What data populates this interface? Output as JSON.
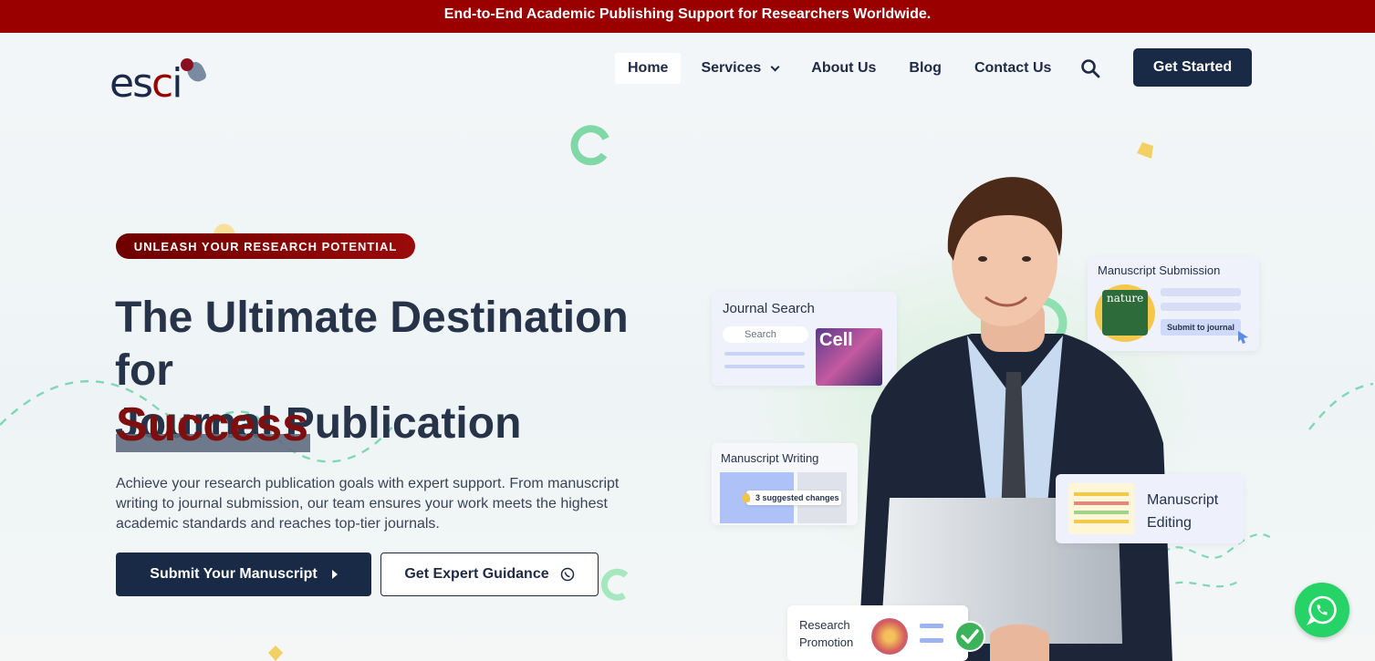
{
  "topbar": {
    "text": "End-to-End Academic Publishing Support for Researchers Worldwide."
  },
  "logo": {
    "text_es": "es",
    "text_c": "c",
    "text_i": "i"
  },
  "nav": {
    "items": [
      "Home",
      "Services",
      "About Us",
      "Blog",
      "Contact Us"
    ],
    "cta": "Get Started"
  },
  "hero": {
    "badge": "UNLEASH YOUR RESEARCH POTENTIAL",
    "title_line1": "The Ultimate Destination for",
    "title_line2": "Journal Publication",
    "title_highlight": "Success",
    "description": "Achieve your research publication goals with expert support. From manuscript writing to journal submission, our team ensures your work meets the highest academic standards and reaches top-tier journals.",
    "primary_button": "Submit Your Manuscript",
    "secondary_button": "Get Expert Guidance"
  },
  "cards": {
    "journal_search": {
      "title": "Journal Search",
      "search_placeholder": "Search",
      "cover_text": "Cell"
    },
    "manuscript_submission": {
      "title": "Manuscript Submission",
      "cover_text": "nature",
      "button": "Submit to journal"
    },
    "manuscript_writing": {
      "title": "Manuscript Writing",
      "suggestion": "3 suggested changes"
    },
    "manuscript_editing": {
      "title_line1": "Manuscript",
      "title_line2": "Editing"
    },
    "research_promotion": {
      "title_line1": "Research",
      "title_line2": "Promotion"
    }
  },
  "colors": {
    "brand_red": "#9b0000",
    "navy": "#182a46",
    "accent_green": "#25d366"
  },
  "icons": [
    "search-icon",
    "chevron-down-icon",
    "play-arrow-icon",
    "whatsapp-icon",
    "check-circle-icon"
  ]
}
